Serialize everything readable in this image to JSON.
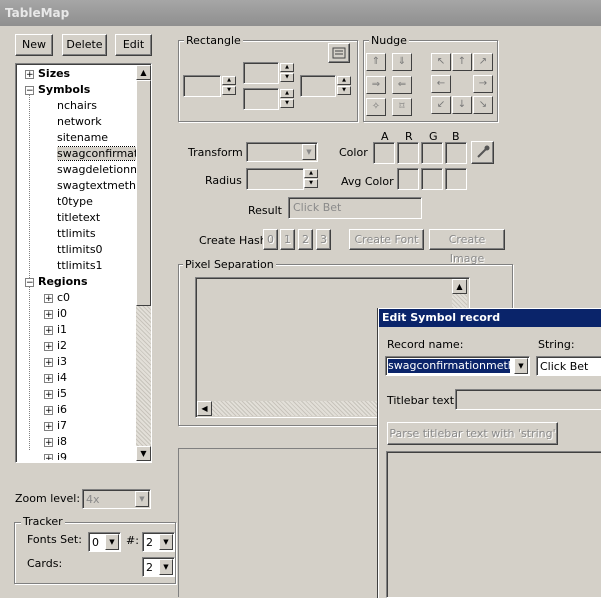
{
  "window": {
    "title": "TableMap"
  },
  "toolbar": {
    "new_label": "New",
    "delete_label": "Delete",
    "edit_label": "Edit"
  },
  "tree": {
    "sizes_label": "Sizes",
    "symbols_label": "Symbols",
    "symbols": [
      "nchairs",
      "network",
      "sitename",
      "swagconfirmatio",
      "swagdeletionme",
      "swagtextmethod",
      "t0type",
      "titletext",
      "ttlimits",
      "ttlimits0",
      "ttlimits1"
    ],
    "regions_label": "Regions",
    "regions": [
      "c0",
      "i0",
      "i1",
      "i2",
      "i3",
      "i4",
      "i5",
      "i6",
      "i7",
      "i8",
      "i9"
    ]
  },
  "zoom": {
    "label": "Zoom level:",
    "value": "4x"
  },
  "tracker": {
    "title": "Tracker",
    "fonts_label": "Fonts Set:",
    "fonts_value": "0",
    "hash_label": "#:",
    "hash_value": "2",
    "cards_label": "Cards:",
    "cards_value": "2"
  },
  "rectangle": {
    "title": "Rectangle"
  },
  "nudge": {
    "title": "Nudge"
  },
  "transform": {
    "label": "Transform",
    "radius_label": "Radius"
  },
  "color": {
    "label": "Color",
    "a": "A",
    "r": "R",
    "g": "G",
    "b": "B",
    "avg_label": "Avg Color"
  },
  "result": {
    "label": "Result",
    "value": "Click Bet"
  },
  "hash": {
    "label": "Create Hash",
    "buttons": [
      "0",
      "1",
      "2",
      "3"
    ],
    "create_font": "Create Font",
    "create_image": "Create Image"
  },
  "pixel_sep": {
    "title": "Pixel Separation"
  },
  "dialog": {
    "title": "Edit Symbol record",
    "record_name_label": "Record name:",
    "record_name_value": "swagconfirmationmethod",
    "string_label": "String:",
    "string_value": "Click Bet",
    "titlebar_label": "Titlebar text:",
    "parse_button": "Parse titlebar text with 'string'"
  }
}
